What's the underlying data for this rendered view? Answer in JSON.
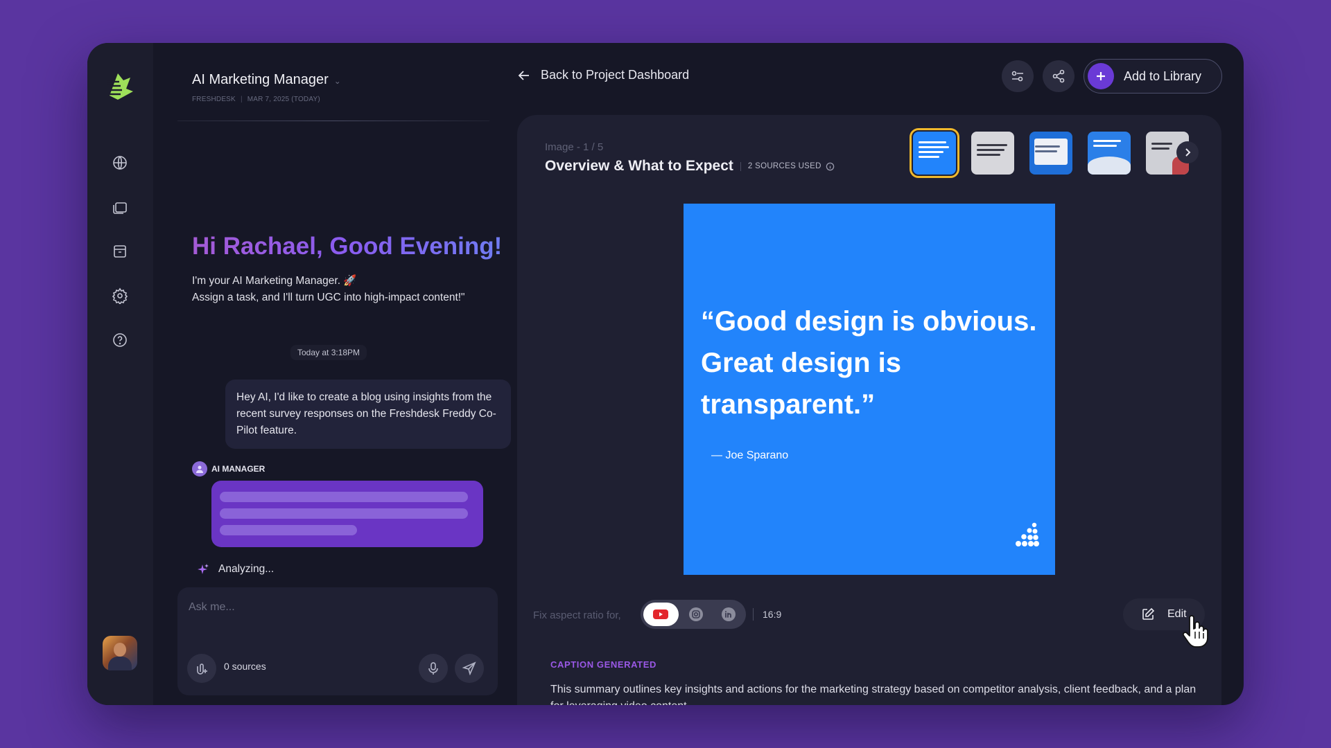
{
  "sidebar": {
    "icons": [
      "globe-icon",
      "folders-icon",
      "archive-icon",
      "settings-icon",
      "help-icon"
    ]
  },
  "chat": {
    "title": "AI Marketing Manager",
    "meta_company": "FRESHDESK",
    "meta_date": "MAR 7, 2025 (TODAY)",
    "greeting": "Hi Rachael, Good Evening!",
    "intro_line1": "I'm your AI Marketing Manager. 🚀",
    "intro_line2": "Assign a task, and I'll turn UGC into high-impact content!\"",
    "timestamp": "Today at 3:18PM",
    "user_message": "Hey AI, I'd like to create a blog using insights from the recent survey responses on the Freshdesk Freddy Co-Pilot feature.",
    "ai_label": "AI MANAGER",
    "status": "Analyzing...",
    "input_placeholder": "Ask me...",
    "sources_count": "0 sources"
  },
  "topbar": {
    "back_label": "Back to Project Dashboard",
    "add_library_label": "Add to Library"
  },
  "preview": {
    "image_count": "Image - 1 / 5",
    "title": "Overview & What to Expect",
    "sources_used": "2 SOURCES USED",
    "quote": "“Good design is obvious. Great design is transparent.”",
    "author": "— Joe Sparano",
    "aspect_label": "Fix aspect ratio for,",
    "aspect_ratio": "16:9",
    "edit_label": "Edit",
    "caption_heading": "CAPTION GENERATED",
    "caption_text": "This summary outlines key insights and actions for the marketing strategy based on competitor analysis, client feedback, and a plan for leveraging video content."
  },
  "thumbnails": [
    {
      "bg": "#2284fb",
      "active": true
    },
    {
      "bg": "#d7d7dc",
      "active": false
    },
    {
      "bg": "#1f6fd9",
      "active": false
    },
    {
      "bg": "#2b7fe8",
      "active": false
    },
    {
      "bg": "#cfd0d6",
      "active": false
    }
  ],
  "colors": {
    "accent": "#6a3ad6",
    "hero_bg": "#2284fb",
    "caption_heading": "#9a58e6"
  }
}
